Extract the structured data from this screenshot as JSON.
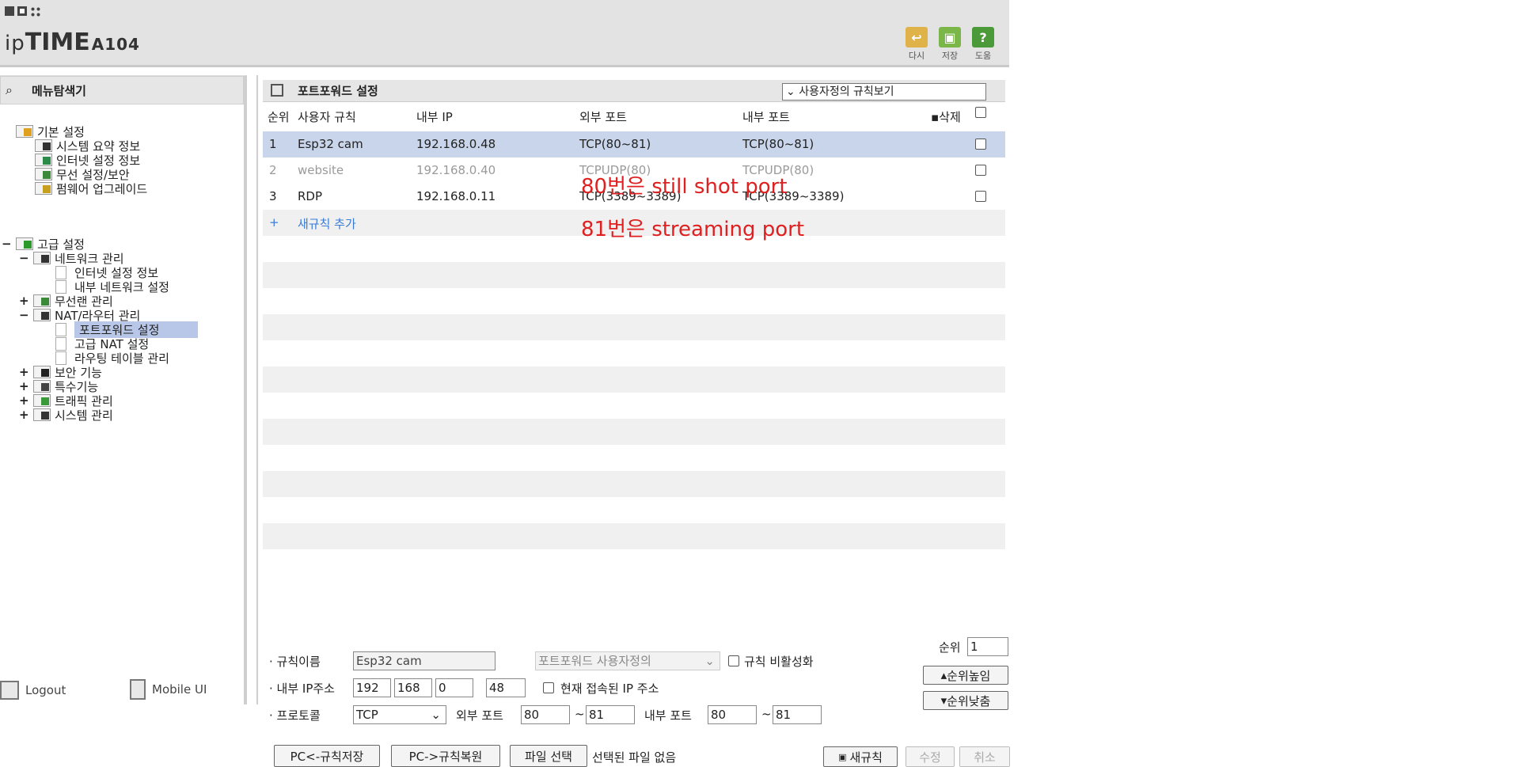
{
  "header": {
    "logo_ip": "ip",
    "logo_time": "TIME",
    "logo_model": "A104",
    "buttons": [
      {
        "icon": "undo-icon",
        "label": "다시",
        "color": "#e0b24a"
      },
      {
        "icon": "save-icon",
        "label": "저장",
        "color": "#7ab648"
      },
      {
        "icon": "help-icon",
        "label": "도움",
        "color": "#4a9a3a",
        "glyph": "?"
      }
    ]
  },
  "sidebar": {
    "title": "메뉴탐색기",
    "basic": {
      "label": "기본 설정",
      "items": [
        "시스템 요약 정보",
        "인터넷 설정 정보",
        "무선 설정/보안",
        "펌웨어 업그레이드"
      ]
    },
    "advanced": {
      "label": "고급 설정",
      "network": {
        "label": "네트워크 관리",
        "items": [
          "인터넷 설정 정보",
          "내부 네트워크 설정"
        ]
      },
      "wireless": "무선랜 관리",
      "nat": {
        "label": "NAT/라우터 관리",
        "items": [
          "포트포워드 설정",
          "고급 NAT 설정",
          "라우팅 테이블 관리"
        ]
      },
      "others": [
        "보안 기능",
        "특수기능",
        "트래픽 관리",
        "시스템 관리"
      ]
    },
    "logout": "Logout",
    "mobile": "Mobile UI"
  },
  "main": {
    "title": "포트포워드 설정",
    "view_select": "사용자정의 규칙보기",
    "columns": {
      "rank": "순위",
      "rule": "사용자 규칙",
      "ip": "내부 IP",
      "ext": "외부 포트",
      "int": "내부 포트",
      "del": "삭제"
    },
    "rows": [
      {
        "rank": "1",
        "rule": "Esp32 cam",
        "ip": "192.168.0.48",
        "ext": "TCP(80~81)",
        "int": "TCP(80~81)"
      },
      {
        "rank": "2",
        "rule": "website",
        "ip": "192.168.0.40",
        "ext": "TCPUDP(80)",
        "int": "TCPUDP(80)"
      },
      {
        "rank": "3",
        "rule": "RDP",
        "ip": "192.168.0.11",
        "ext": "TCP(3389~3389)",
        "int": "TCP(3389~3389)"
      }
    ],
    "add_rule": "새규칙 추가",
    "annotations": [
      "80번은 still shot port",
      "81번은 streaming port"
    ]
  },
  "form": {
    "rule_name_label": "규칙이름",
    "rule_name": "Esp32 cam",
    "type_select": "포트포워드 사용자정의",
    "disable_rule": "규칙 비활성화",
    "ip_label": "내부 IP주소",
    "ip": [
      "192",
      "168",
      "0",
      "48"
    ],
    "current_ip": "현재 접속된 IP 주소",
    "protocol_label": "프로토콜",
    "protocol": "TCP",
    "ext_port_label": "외부 포트",
    "ext_from": "80",
    "ext_to": "81",
    "int_port_label": "내부 포트",
    "int_from": "80",
    "int_to": "81",
    "tilde": "~",
    "rank_label": "순위",
    "rank": "1",
    "rank_up": "순위높임",
    "rank_down": "순위낮춤",
    "save_pc": "PC<-규칙저장",
    "restore_pc": "PC->규칙복원",
    "file_select": "파일 선택",
    "no_file": "선택된 파일 없음",
    "new_rule": "새규칙",
    "modify": "수정",
    "cancel": "취소"
  }
}
